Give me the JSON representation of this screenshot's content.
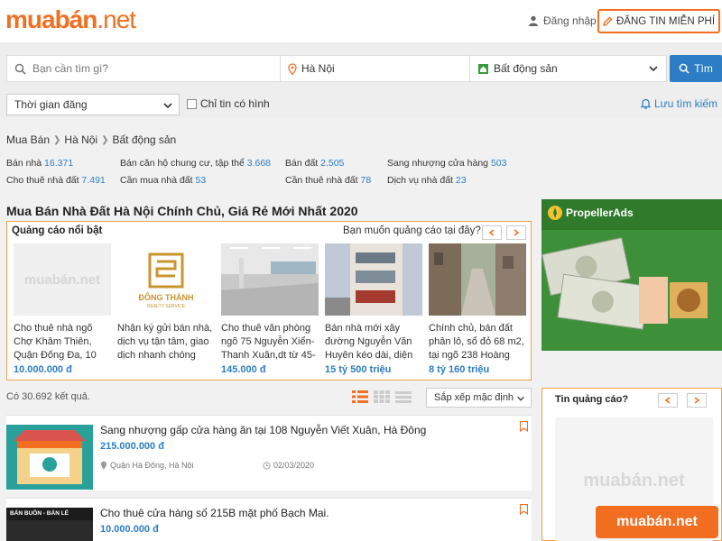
{
  "header": {
    "logo_brand": "muabán",
    "logo_tld": ".net",
    "login_label": "Đăng nhập",
    "post_label": "ĐĂNG TIN MIỄN PHÍ"
  },
  "search": {
    "placeholder": "Bạn cần tìm gì?",
    "location": "Hà Nội",
    "category": "Bất động sản",
    "button_label": "Tìm",
    "time_filter": "Thời gian đăng",
    "image_only_label": "Chỉ tin có hình",
    "save_label": "Lưu tìm kiếm"
  },
  "breadcrumb": [
    "Mua Bán",
    "Hà Nội",
    "Bất động sản"
  ],
  "categories": [
    {
      "label": "Bán nhà",
      "count": "16.371"
    },
    {
      "label": "Bán căn hộ chung cư, tập thể",
      "count": "3.668"
    },
    {
      "label": "Bán đất",
      "count": "2.505"
    },
    {
      "label": "Sang nhượng cửa hàng",
      "count": "503"
    },
    {
      "label": "Cho thuê nhà đất",
      "count": "7.491"
    },
    {
      "label": "Cần mua nhà đất",
      "count": "53"
    },
    {
      "label": "Cần thuê nhà đất",
      "count": "78"
    },
    {
      "label": "Dịch vụ nhà đất",
      "count": "23"
    }
  ],
  "page_title": "Mua Bán Nhà Đất Hà Nội Chính Chủ, Giá Rẻ Mới Nhất 2020",
  "featured": {
    "heading": "Quảng cáo nổi bật",
    "ask": "Bạn muốn quảng cáo tại đây?",
    "prev_icon": "chevron-left-icon",
    "next_icon": "chevron-right-icon",
    "items": [
      {
        "title": "Cho thuê nhà ngõ Chợ Khâm Thiên, Quận Đống Đa, 10",
        "price": "10.000.000 đ",
        "thumb_text": "muabán.net"
      },
      {
        "title": "Nhận ký gửi bán nhà, dịch vụ tận tâm, giao dịch nhanh chóng",
        "price": "",
        "thumb_text": "ĐÔNG THÀNH",
        "thumb_sub": "REALTY SERVICE"
      },
      {
        "title": "Cho thuê văn phòng ngõ 75 Nguyễn Xiển-Thanh Xuân,dt từ 45-",
        "price": "145.000 đ"
      },
      {
        "title": "Bán nhà mới xây đường Nguyễn Văn Huyên kéo dài, diện",
        "price": "15 tỷ 500 triệu"
      },
      {
        "title": "Chính chủ, bán đất phân lô, sổ đỏ 68 m2, tại ngõ 238 Hoàng",
        "price": "8 tỷ 160 triệu"
      }
    ]
  },
  "results": {
    "count_text": "Có 30.692 kết quả.",
    "sort_label": "Sắp xếp mặc định"
  },
  "listings": [
    {
      "title": "Sang nhượng gấp cửa hàng ăn tại 108 Nguyễn Viết Xuân, Hà Đông",
      "price": "215.000.000 đ",
      "location": "Quận Hà Đông, Hà Nội",
      "date": "02/03/2020"
    },
    {
      "title": "Cho thuê cửa hàng số 215B mặt phố Bạch Mai.",
      "price": "10.000.000 đ",
      "thumb_text": "BÁN BUÔN - BÁN LẺ"
    }
  ],
  "sidebar": {
    "banner_brand": "PropellerAds",
    "ad_heading": "Tin quảng cáo?",
    "ad_watermark": "muabán.net",
    "corner_logo": "muabán.net"
  },
  "colors": {
    "brand": "#f26f21",
    "link": "#2c7dc3"
  }
}
